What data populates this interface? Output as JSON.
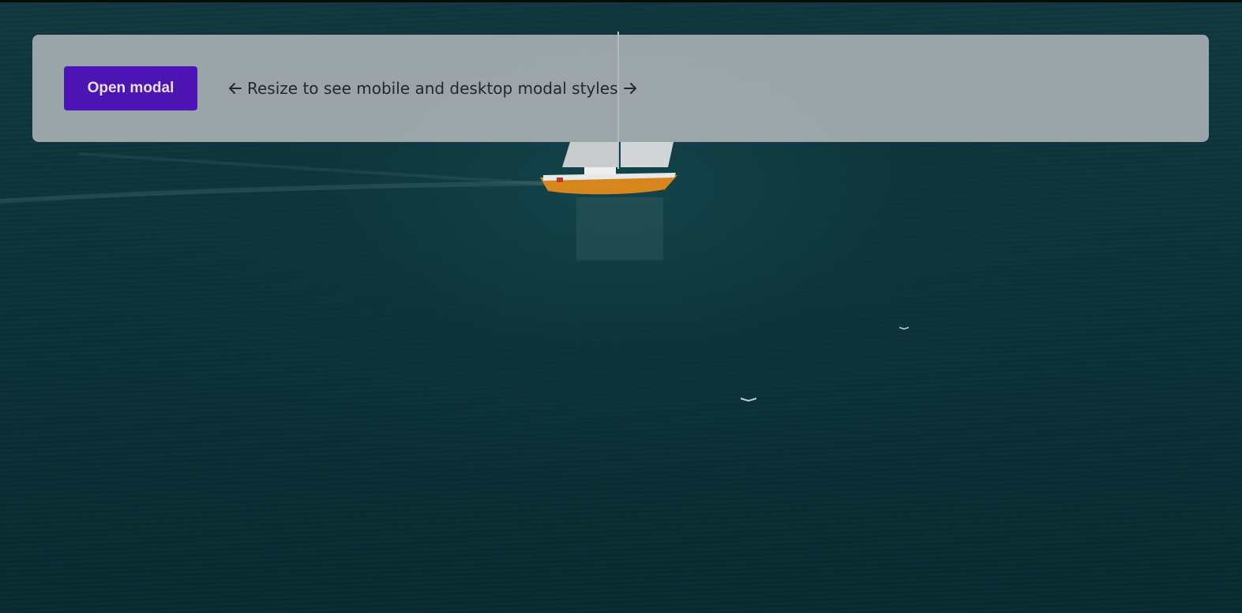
{
  "background": {
    "scene": "sailboat on open sea",
    "water_color": "#0f3f47"
  },
  "panel": {
    "open_button_label": "Open modal",
    "hint_text": "Resize to see mobile and desktop modal styles",
    "left_icon": "arrow-left-icon",
    "right_icon": "arrow-right-icon"
  },
  "colors": {
    "button_bg": "#4c14b3",
    "panel_bg": "#b2b7bb"
  }
}
